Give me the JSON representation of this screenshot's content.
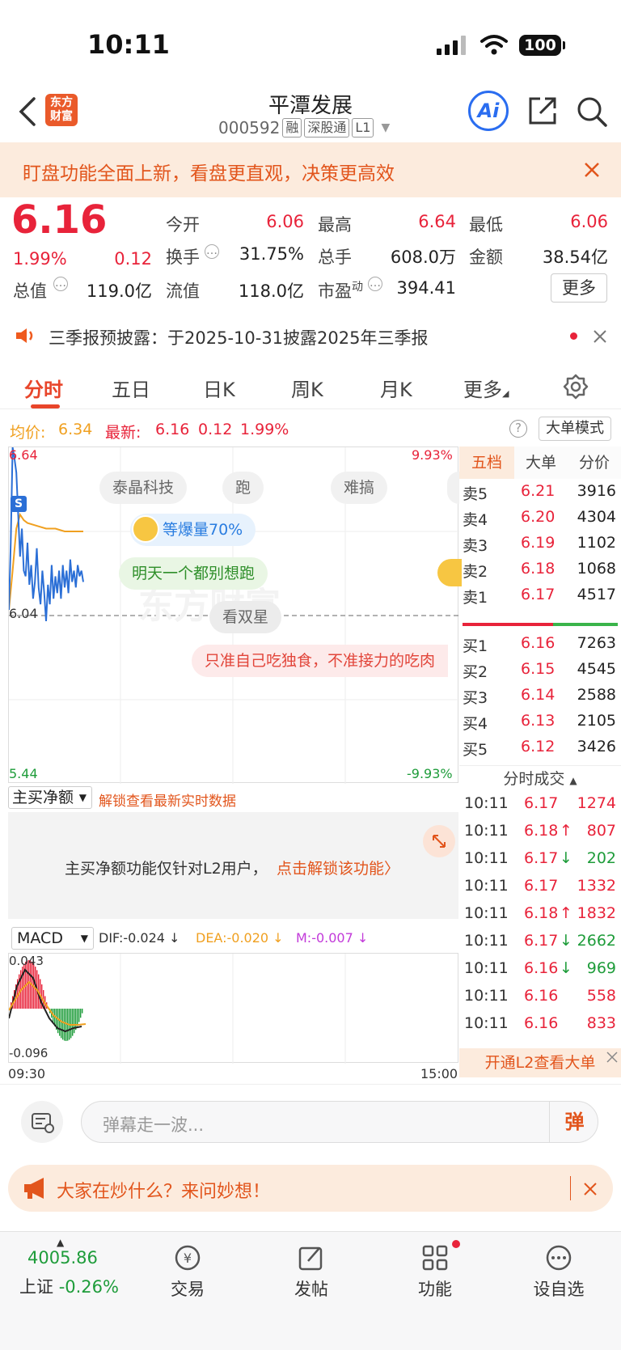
{
  "status": {
    "time": "10:11",
    "battery": "100"
  },
  "header": {
    "logo_text": "东方财富",
    "title": "平潭发展",
    "code": "000592",
    "tags": [
      "融",
      "深股通",
      "L1"
    ],
    "ai_label": "Ai"
  },
  "banner": {
    "text": "盯盘功能全面上新，看盘更直观，决策更高效"
  },
  "quote": {
    "price": "6.16",
    "pct": "1.99%",
    "chg": "0.12",
    "open_label": "今开",
    "open": "6.06",
    "high_label": "最高",
    "high": "6.64",
    "low_label": "最低",
    "low": "6.06",
    "turnover_label": "换手",
    "turnover": "31.75%",
    "volume_label": "总手",
    "volume": "608.0万",
    "amount_label": "金额",
    "amount": "38.54亿",
    "mktcap_label": "总值",
    "mktcap": "119.0亿",
    "float_label": "流值",
    "float": "118.0亿",
    "pe_label": "市盈",
    "pe_sup": "动",
    "pe": "394.41",
    "more_label": "更多"
  },
  "notice": {
    "text": "三季报预披露：于2025-10-31披露2025年三季报"
  },
  "tabs": [
    "分时",
    "五日",
    "日K",
    "周K",
    "月K",
    "更多"
  ],
  "avgline": {
    "avg_label": "均价:",
    "avg": "6.34",
    "latest_label": "最新:",
    "latest": "6.16",
    "chg": "0.12",
    "pct": "1.99%",
    "mode_button": "大单模式"
  },
  "chart": {
    "ymax": "6.64",
    "ymid": "6.04",
    "ymin": "5.44",
    "pmax": "9.93%",
    "pmin": "-9.93%",
    "watermark": "东方财富",
    "marker": "S",
    "bubbles": [
      "泰晶科技",
      "跑",
      "难搞",
      "等爆量70%",
      "明天一个都别想跑",
      "看双星",
      "只准自己吃独食，不准接力的吃肉"
    ]
  },
  "chart_data": {
    "type": "line",
    "title": "",
    "ylim": [
      5.44,
      6.64
    ],
    "ylim_pct": [
      -9.93,
      9.93
    ],
    "prev_close": 6.04,
    "x_range": [
      "09:30",
      "15:00"
    ],
    "series": [
      {
        "name": "",
        "x_index": [
          0,
          1,
          2,
          3,
          4,
          5,
          6,
          7,
          8,
          9,
          10,
          11,
          12,
          13,
          14,
          15,
          16,
          17,
          18,
          19,
          20,
          21,
          22,
          23,
          24,
          25,
          26,
          27,
          28,
          29,
          30,
          31,
          32,
          33,
          34,
          35,
          36,
          37,
          38,
          39,
          40
        ],
        "values": [
          6.06,
          6.3,
          6.64,
          6.6,
          6.55,
          6.4,
          6.25,
          6.35,
          6.2,
          6.18,
          6.3,
          6.15,
          6.22,
          6.1,
          6.16,
          6.28,
          6.14,
          6.08,
          6.2,
          6.12,
          6.02,
          6.15,
          6.08,
          6.22,
          6.1,
          6.18,
          6.12,
          6.2,
          6.1,
          6.22,
          6.14,
          6.2,
          6.12,
          6.24,
          6.16,
          6.2,
          6.14,
          6.22,
          6.18,
          6.2,
          6.16
        ]
      },
      {
        "name": "均价",
        "x_index": [
          0,
          2,
          4,
          6,
          8,
          10,
          15,
          20,
          25,
          30,
          35,
          40
        ],
        "values": [
          6.06,
          6.2,
          6.35,
          6.4,
          6.38,
          6.37,
          6.36,
          6.35,
          6.35,
          6.34,
          6.34,
          6.34
        ]
      }
    ]
  },
  "orderbook": {
    "tabs": [
      "五档",
      "大单",
      "分价"
    ],
    "asks": [
      [
        "卖5",
        "6.21",
        "3916"
      ],
      [
        "卖4",
        "6.20",
        "4304"
      ],
      [
        "卖3",
        "6.19",
        "1102"
      ],
      [
        "卖2",
        "6.18",
        "1068"
      ],
      [
        "卖1",
        "6.17",
        "4517"
      ]
    ],
    "bids": [
      [
        "买1",
        "6.16",
        "7263"
      ],
      [
        "买2",
        "6.15",
        "4545"
      ],
      [
        "买3",
        "6.14",
        "2588"
      ],
      [
        "买4",
        "6.13",
        "2105"
      ],
      [
        "买5",
        "6.12",
        "3426"
      ]
    ],
    "trades_title": "分时成交",
    "trades": [
      [
        "10:11",
        "6.17",
        "",
        "1274"
      ],
      [
        "10:11",
        "6.18",
        "↑",
        "807"
      ],
      [
        "10:11",
        "6.17",
        "↓",
        "202"
      ],
      [
        "10:11",
        "6.17",
        "",
        "1332"
      ],
      [
        "10:11",
        "6.18",
        "↑",
        "1832"
      ],
      [
        "10:11",
        "6.17",
        "↓",
        "2662"
      ],
      [
        "10:11",
        "6.16",
        "↓",
        "969"
      ],
      [
        "10:11",
        "6.16",
        "",
        "558"
      ],
      [
        "10:11",
        "6.16",
        "",
        "833"
      ]
    ],
    "l2_button": "开通L2查看大单"
  },
  "netbuy": {
    "selector": "主买净额",
    "unlock": "解锁查看最新实时数据",
    "info": "主买净额功能仅针对L2用户，",
    "info_link": "点击解锁该功能"
  },
  "macd": {
    "selector": "MACD",
    "dif": "DIF:-0.024 ↓",
    "dea": "DEA:-0.020 ↓",
    "m": "M:-0.007 ↓",
    "top": "0.043",
    "bottom": "-0.096",
    "time_start": "09:30",
    "time_end": "15:00"
  },
  "danmu": {
    "placeholder": "弹幕走一波...",
    "send_label": "弹"
  },
  "ask": {
    "text": "大家在炒什么？来问妙想！"
  },
  "bottom": {
    "index_value": "4005.86",
    "index_name": "上证",
    "index_pct": "-0.26%",
    "items": [
      "交易",
      "发帖",
      "功能",
      "设自选"
    ]
  }
}
